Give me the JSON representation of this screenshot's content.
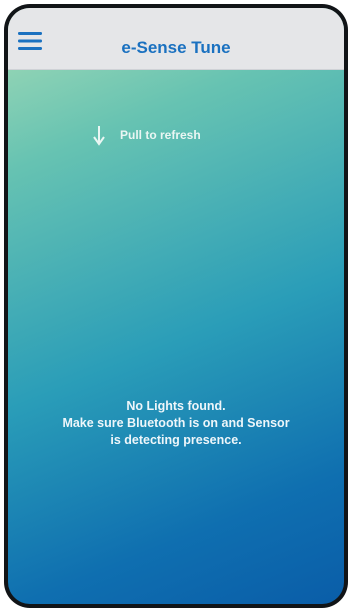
{
  "header": {
    "title": "e-Sense Tune",
    "menu_icon": "hamburger-menu-icon"
  },
  "pull_hint": {
    "icon": "arrow-down-icon",
    "label": "Pull to refresh"
  },
  "empty_state": {
    "line1": "No Lights found.",
    "line2": "Make sure Bluetooth is on and Sensor",
    "line3": "is detecting presence."
  },
  "colors": {
    "accent": "#1a71c0",
    "header_bg": "#e5e6e8",
    "gradient_top": "#a7dcb6",
    "gradient_bottom": "#0a5da8"
  }
}
